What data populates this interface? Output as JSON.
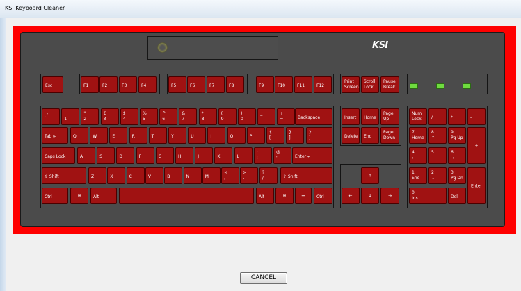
{
  "window": {
    "title": "KSI Keyboard Cleaner"
  },
  "keyboard": {
    "brand": "KSI",
    "indicator_color": "#6fdc3f",
    "key_color": "#a01212",
    "frame_color": "#ff0000"
  },
  "keys": {
    "esc": "Esc",
    "f1": "F1",
    "f2": "F2",
    "f3": "F3",
    "f4": "F4",
    "f5": "F5",
    "f6": "F6",
    "f7": "F7",
    "f8": "F8",
    "f9": "F9",
    "f10": "F10",
    "f11": "F11",
    "f12": "F12",
    "print_screen": [
      "Print",
      "Screen"
    ],
    "scroll_lock": [
      "Scroll",
      "Lock"
    ],
    "pause_break": [
      "Pause",
      "Break"
    ],
    "number_row": [
      [
        "¬",
        "`"
      ],
      [
        "!",
        "1"
      ],
      [
        "\"",
        "2"
      ],
      [
        "£",
        "3"
      ],
      [
        "$",
        "4"
      ],
      [
        "%",
        "5"
      ],
      [
        "^",
        "6"
      ],
      [
        "&",
        "7"
      ],
      [
        "*",
        "8"
      ],
      [
        "(",
        "9"
      ],
      [
        ")",
        "0"
      ],
      [
        "_",
        "-"
      ],
      [
        "+",
        "="
      ]
    ],
    "backspace": "Backspace",
    "tab": "Tab ⇤",
    "q_row": [
      "Q",
      "W",
      "E",
      "R",
      "T",
      "Y",
      "U",
      "I",
      "O",
      "P",
      [
        "{",
        "["
      ],
      [
        "}",
        "]"
      ]
    ],
    "caps_lock": "Caps Lock",
    "a_row": [
      "A",
      "S",
      "D",
      "F",
      "G",
      "H",
      "J",
      "K",
      "L",
      [
        ":",
        ";"
      ],
      [
        "@",
        "'"
      ]
    ],
    "enter": "Enter ↵",
    "shift_left": "⇧ Shift",
    "z_row": [
      "Z",
      "X",
      "C",
      "V",
      "B",
      "N",
      "M",
      [
        "<",
        ","
      ],
      [
        ">",
        "."
      ],
      [
        "?",
        "/"
      ]
    ],
    "shift_right": "⇧ Shift",
    "ctrl_left": "Ctrl",
    "win_left": "⊞",
    "alt_left": "Alt",
    "space": "",
    "alt_right": "Alt",
    "win_right": "⊞",
    "menu": "☰",
    "ctrl_right": "Ctrl",
    "insert": "Insert",
    "home": "Home",
    "page_up": [
      "Page",
      "Up"
    ],
    "delete": "Delete",
    "end": "End",
    "page_down": [
      "Page",
      "Down"
    ],
    "arrow_up": "↑",
    "arrow_left": "←",
    "arrow_down": "↓",
    "arrow_right": "→",
    "num_lock": [
      "Num",
      "Lock"
    ],
    "num_div": "/",
    "num_mul": "*",
    "num_minus": "-",
    "num7": [
      "7",
      "Home"
    ],
    "num8": [
      "8",
      "↑"
    ],
    "num9": [
      "9",
      "Pg Up"
    ],
    "num_plus": "+",
    "num4": [
      "4",
      "←"
    ],
    "num5": [
      "5",
      ""
    ],
    "num6": [
      "6",
      "→"
    ],
    "num1": [
      "1",
      "End"
    ],
    "num2": [
      "2",
      "↓"
    ],
    "num3": [
      "3",
      "Pg Dn"
    ],
    "num_enter": "Enter",
    "num0": [
      "0",
      "Ins"
    ],
    "num_del": "Del"
  },
  "buttons": {
    "cancel": "CANCEL"
  }
}
